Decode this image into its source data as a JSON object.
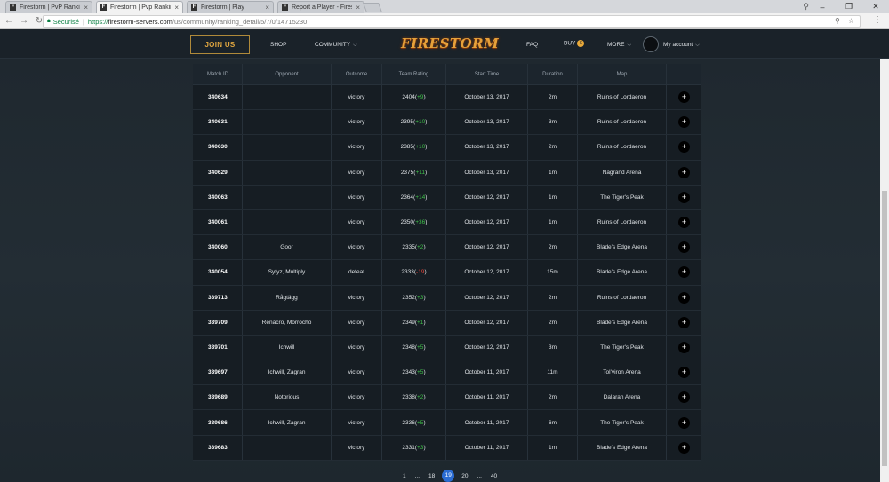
{
  "browser": {
    "tabs": [
      {
        "title": "Firestorm | PvP Ranking",
        "favicon": "F"
      },
      {
        "title": "Firestorm | Pvp Ranking",
        "favicon": "F"
      },
      {
        "title": "Firestorm | Play",
        "favicon": "F"
      },
      {
        "title": "Report a Player - Firesto",
        "favicon": "F"
      }
    ],
    "secure_label": "Sécurisé",
    "url_scheme": "https://",
    "url_host": "firestorm-servers.com",
    "url_path": "/us/community/ranking_detail/5/7/0/14715230"
  },
  "site": {
    "join_label": "JOIN US",
    "nav": {
      "shop": "SHOP",
      "community": "COMMUNITY",
      "faq": "FAQ",
      "buy": "BUY",
      "more": "MORE"
    },
    "logo": "FIRESTORM",
    "account_label": "My account"
  },
  "table": {
    "headers": [
      "Match ID",
      "Opponent",
      "Outcome",
      "Team Rating",
      "Start Time",
      "Duration",
      "Map"
    ],
    "rows": [
      {
        "id": "340634",
        "opponent": "",
        "outcome": "victory",
        "rating": "2404",
        "delta": "+9",
        "date": "October 13, 2017",
        "duration": "2m",
        "map": "Ruins of Lordaeron"
      },
      {
        "id": "340631",
        "opponent": "",
        "outcome": "victory",
        "rating": "2395",
        "delta": "+10",
        "date": "October 13, 2017",
        "duration": "3m",
        "map": "Ruins of Lordaeron"
      },
      {
        "id": "340630",
        "opponent": "",
        "outcome": "victory",
        "rating": "2385",
        "delta": "+10",
        "date": "October 13, 2017",
        "duration": "2m",
        "map": "Ruins of Lordaeron"
      },
      {
        "id": "340629",
        "opponent": "",
        "outcome": "victory",
        "rating": "2375",
        "delta": "+11",
        "date": "October 13, 2017",
        "duration": "1m",
        "map": "Nagrand Arena"
      },
      {
        "id": "340063",
        "opponent": "",
        "outcome": "victory",
        "rating": "2364",
        "delta": "+14",
        "date": "October 12, 2017",
        "duration": "1m",
        "map": "The Tiger's Peak"
      },
      {
        "id": "340061",
        "opponent": "",
        "outcome": "victory",
        "rating": "2350",
        "delta": "+36",
        "date": "October 12, 2017",
        "duration": "1m",
        "map": "Ruins of Lordaeron"
      },
      {
        "id": "340060",
        "opponent": "Goor",
        "outcome": "victory",
        "rating": "2335",
        "delta": "+2",
        "date": "October 12, 2017",
        "duration": "2m",
        "map": "Blade's Edge Arena"
      },
      {
        "id": "340054",
        "opponent": "Syfyz, Multiply",
        "outcome": "defeat",
        "rating": "2333",
        "delta": "-19",
        "date": "October 12, 2017",
        "duration": "15m",
        "map": "Blade's Edge Arena"
      },
      {
        "id": "339713",
        "opponent": "Rågtägg",
        "outcome": "victory",
        "rating": "2352",
        "delta": "+3",
        "date": "October 12, 2017",
        "duration": "2m",
        "map": "Ruins of Lordaeron"
      },
      {
        "id": "339709",
        "opponent": "Renacro, Morrocho",
        "outcome": "victory",
        "rating": "2349",
        "delta": "+1",
        "date": "October 12, 2017",
        "duration": "2m",
        "map": "Blade's Edge Arena"
      },
      {
        "id": "339701",
        "opponent": "Ichwill",
        "outcome": "victory",
        "rating": "2348",
        "delta": "+5",
        "date": "October 12, 2017",
        "duration": "3m",
        "map": "The Tiger's Peak"
      },
      {
        "id": "339697",
        "opponent": "Ichwill, Zagran",
        "outcome": "victory",
        "rating": "2343",
        "delta": "+5",
        "date": "October 11, 2017",
        "duration": "11m",
        "map": "Tol'viron Arena"
      },
      {
        "id": "339689",
        "opponent": "Notorious",
        "outcome": "victory",
        "rating": "2338",
        "delta": "+2",
        "date": "October 11, 2017",
        "duration": "2m",
        "map": "Dalaran Arena"
      },
      {
        "id": "339686",
        "opponent": "Ichwill, Zagran",
        "outcome": "victory",
        "rating": "2336",
        "delta": "+5",
        "date": "October 11, 2017",
        "duration": "6m",
        "map": "The Tiger's Peak"
      },
      {
        "id": "339683",
        "opponent": "",
        "outcome": "victory",
        "rating": "2331",
        "delta": "+3",
        "date": "October 11, 2017",
        "duration": "1m",
        "map": "Blade's Edge Arena"
      }
    ]
  },
  "pagination": {
    "items": [
      "1",
      "...",
      "18",
      "19",
      "20",
      "...",
      "40"
    ],
    "current": "19"
  },
  "colors": {
    "accent": "#e3a840",
    "positive": "#3fbf4a",
    "negative": "#e0443a",
    "page_active": "#2b6cd2"
  }
}
